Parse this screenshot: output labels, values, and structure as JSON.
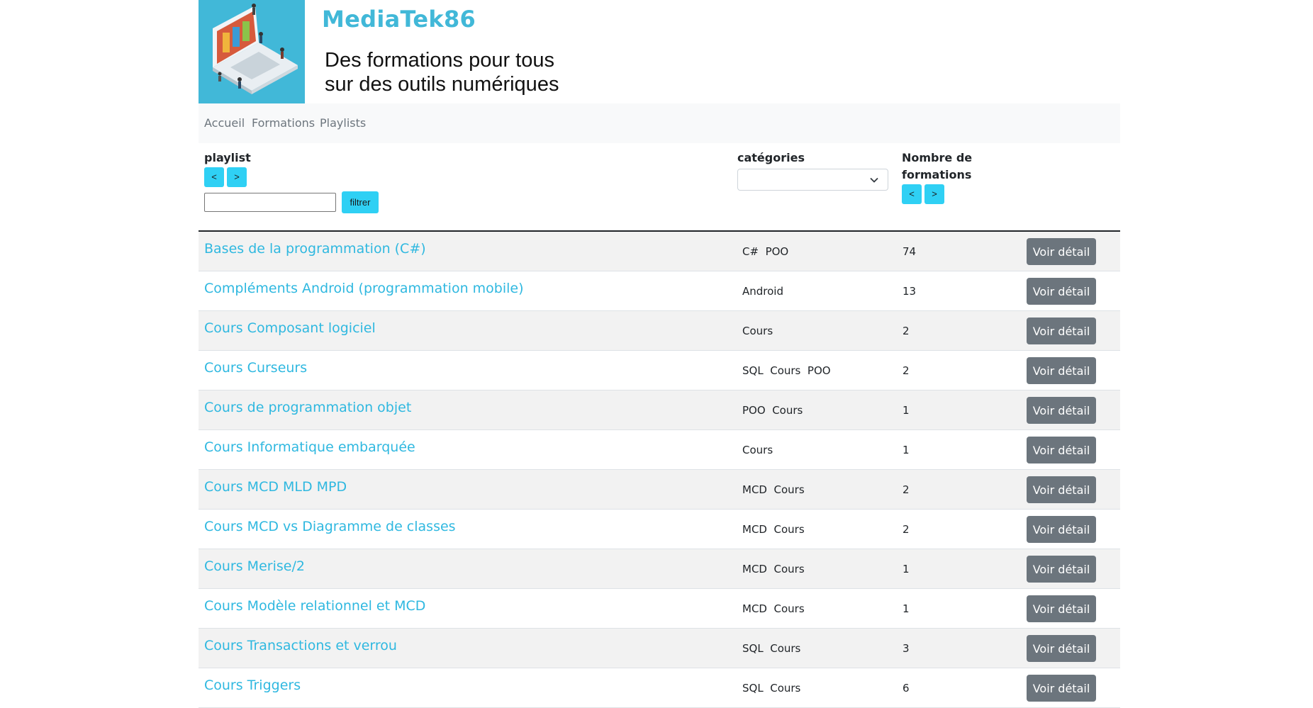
{
  "site": {
    "title": "MediaTek86",
    "tagline_line1": "Des formations pour tous",
    "tagline_line2": "sur des outils numériques"
  },
  "nav": [
    {
      "label": "Accueil"
    },
    {
      "label": "Formations"
    },
    {
      "label": "Playlists"
    }
  ],
  "filters": {
    "playlist_label": "playlist",
    "sort_asc": "<",
    "sort_desc": ">",
    "playlist_input_value": "",
    "filter_button": "filtrer",
    "categories_label": "catégories",
    "categories_selected": "",
    "count_label_line1": "Nombre de",
    "count_label_line2": "formations"
  },
  "playlists": [
    {
      "name": "Bases de la programmation (C#)",
      "categories": "C#  POO",
      "count": "74",
      "action": "Voir détail"
    },
    {
      "name": "Compléments Android (programmation mobile)",
      "categories": "Android",
      "count": "13",
      "action": "Voir détail"
    },
    {
      "name": "Cours Composant logiciel",
      "categories": "Cours",
      "count": "2",
      "action": "Voir détail"
    },
    {
      "name": "Cours Curseurs",
      "categories": "SQL  Cours  POO",
      "count": "2",
      "action": "Voir détail"
    },
    {
      "name": "Cours de programmation objet",
      "categories": "POO  Cours",
      "count": "1",
      "action": "Voir détail"
    },
    {
      "name": "Cours Informatique embarquée",
      "categories": "Cours",
      "count": "1",
      "action": "Voir détail"
    },
    {
      "name": "Cours MCD MLD MPD",
      "categories": "MCD  Cours",
      "count": "2",
      "action": "Voir détail"
    },
    {
      "name": "Cours MCD vs Diagramme de classes",
      "categories": "MCD  Cours",
      "count": "2",
      "action": "Voir détail"
    },
    {
      "name": "Cours Merise/2",
      "categories": "MCD  Cours",
      "count": "1",
      "action": "Voir détail"
    },
    {
      "name": "Cours Modèle relationnel et MCD",
      "categories": "MCD  Cours",
      "count": "1",
      "action": "Voir détail"
    },
    {
      "name": "Cours Transactions et verrou",
      "categories": "SQL  Cours",
      "count": "3",
      "action": "Voir détail"
    },
    {
      "name": "Cours Triggers",
      "categories": "SQL  Cours",
      "count": "6",
      "action": "Voir détail"
    }
  ]
}
